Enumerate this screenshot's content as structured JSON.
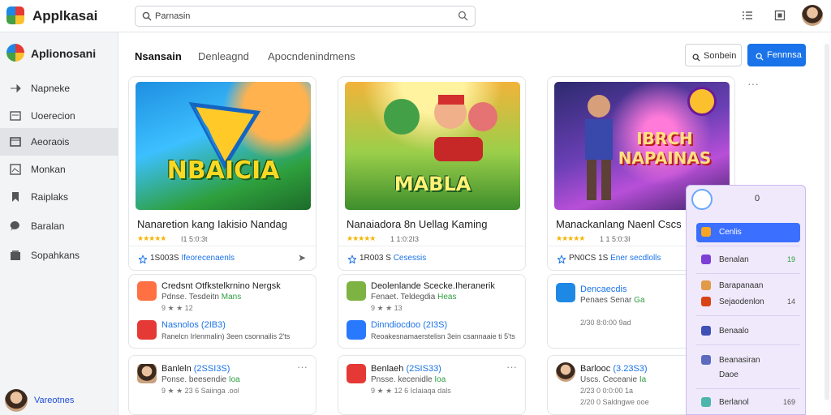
{
  "app": {
    "title": "Applkasai"
  },
  "search": {
    "placeholder": "Parnasin"
  },
  "sidebar": {
    "title": "Aplionosani",
    "items": [
      {
        "label": "Napneke",
        "icon": "arrow-icon"
      },
      {
        "label": "Uoerecion",
        "icon": "list-icon"
      },
      {
        "label": "Aeoraois",
        "icon": "folder-icon"
      },
      {
        "label": "Monkan",
        "icon": "image-icon"
      },
      {
        "label": "Raiplaks",
        "icon": "bookmark-icon"
      },
      {
        "label": "Baralan",
        "icon": "chat-icon"
      },
      {
        "label": "Sopahkans",
        "icon": "stack-icon"
      }
    ],
    "active_index": 2,
    "user": "Vareotnes"
  },
  "tabs": [
    {
      "label": "Nsansain"
    },
    {
      "label": "Denleagnd"
    },
    {
      "label": "Apocndenindmens"
    }
  ],
  "toolbar": {
    "secondary_label": "Sonbein",
    "primary_label": "Fennnsa"
  },
  "featured": [
    {
      "game_logo": "NBAICIA",
      "name": "Nanaretion kang Iakisio Nandag",
      "rating": "I1 5:0:3t",
      "foot_prefix": "1S003S",
      "foot_link": "Ifeorecenaenls"
    },
    {
      "game_logo": "MABLA",
      "name": "Nanaiadora 8n Uellag Kaming",
      "rating": "1 1:0:2I3",
      "foot_prefix": "1R003 S",
      "foot_link": "Cesessis"
    },
    {
      "game_logo": "IBRCH NAPAINAS",
      "name": "Manackanlang Naenl Cscs",
      "rating": "1 1 5:0:3I",
      "foot_prefix": "PN0CS 1S",
      "foot_link": "Ener secdlolls"
    }
  ],
  "lists": {
    "col1_top": [
      {
        "t1": "Credsnt Otfkstelkrnino Nergsk",
        "t2a": "Pdnse. Tesdeitn ",
        "t2b": "Mans",
        "t3": "9 ★ ★ 12",
        "color": "#ff7043"
      },
      {
        "t1": "Nasnolos (2IB3)",
        "t2": "Ranelcn Irlenmalin) 3een csonnailis 2'ts",
        "color": "#e53935"
      }
    ],
    "col1_bottom": {
      "t1": "Banleln ",
      "t1b": "(2SSI3S)",
      "t2a": "Ponse. beesendie ",
      "t2b": "Ioa",
      "t3": "9 ★ ★ 23   6 Saiinga .ool"
    },
    "col2_top": [
      {
        "t1": "Deolenlande Scecke.Iheranerik",
        "t2a": "Fenaet. Teldegdia ",
        "t2b": "Heas",
        "t3": "9 ★ ★ 13",
        "color": "#7cb342"
      },
      {
        "t1": "Dinndiocdoo (2I3S)",
        "t2": "Reoakesnamaerstelisn 3ein csannaaie ti 5'ts",
        "color": "#2979ff"
      }
    ],
    "col2_bottom": {
      "t1": "Benlaeh ",
      "t1b": "(2SIS33)",
      "t2a": "Pnsse. kecenidle ",
      "t2b": "Ioa",
      "t3": "9 ★ ★ 12   6 Iclaiaqa dals"
    },
    "col3_top": {
      "t1": "Dencaecdis",
      "t2a": "Penaes Senar ",
      "t2b": "Ga",
      "t3": "2/30 8:0:00   9ad",
      "color": "#1e88e5"
    },
    "col3_bottom": {
      "t1": "Barlooc ",
      "t1b": "(3.23S3)",
      "t2": "Uscs. Ceceanie ",
      "t2b": "Ia",
      "t3": "2/23 0 0:0:00   1a",
      "t4": "2/20 0 Saldngwe ooe"
    }
  },
  "panel": {
    "badge": "0",
    "rows": [
      {
        "label": "Cenlis",
        "num": "",
        "color": "#f6a623"
      },
      {
        "label": "Benalan",
        "num": "19",
        "color": "#7e3fd6"
      },
      {
        "label": "Barapanaan",
        "num": "",
        "color": "#e09a4a"
      },
      {
        "label": "Sejaodenlon",
        "num": "14",
        "color": "#d84315"
      },
      {
        "label": "Benaalo",
        "num": "",
        "color": "#3f51b5"
      },
      {
        "label": "Beanasiran",
        "num": "",
        "color": "#5c6bc0"
      },
      {
        "label": "Daoe",
        "num": "",
        "color": ""
      },
      {
        "label": "Berlanol",
        "num": "169",
        "color": "#4db6ac"
      }
    ]
  },
  "colors": {
    "accent": "#1a73e8",
    "panel": "#efe9fb",
    "active_panel_row": "#3b6fff"
  }
}
